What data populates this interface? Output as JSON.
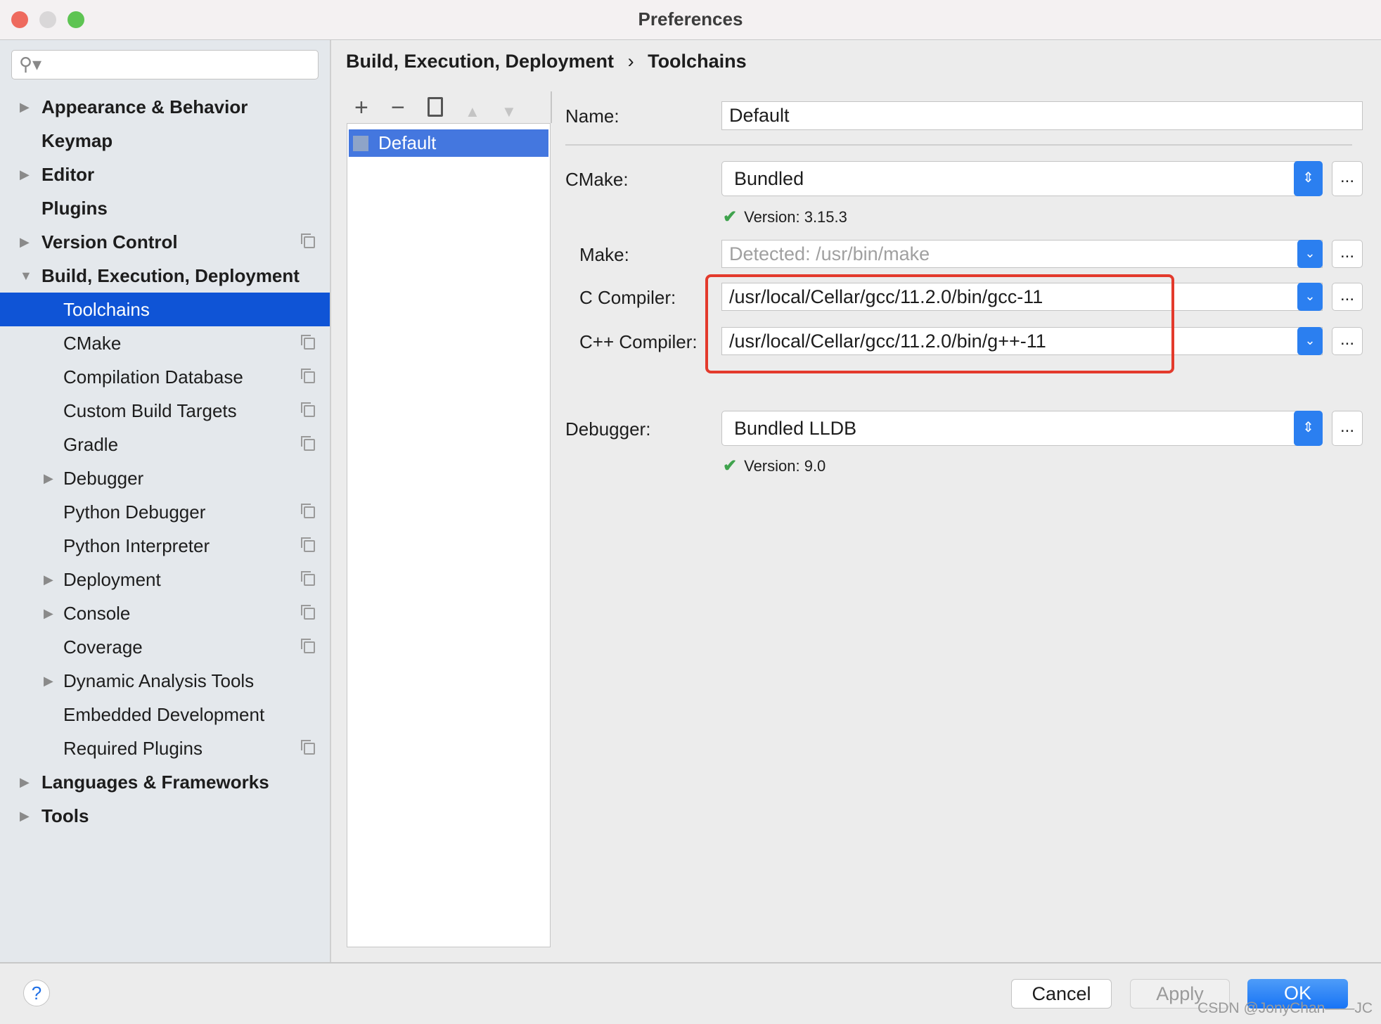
{
  "window": {
    "title": "Preferences"
  },
  "sidebar": {
    "search_placeholder": "",
    "items": [
      {
        "label": "Appearance & Behavior",
        "level": 0,
        "expandable": true,
        "bold": true
      },
      {
        "label": "Keymap",
        "level": 0,
        "bold": true
      },
      {
        "label": "Editor",
        "level": 0,
        "expandable": true,
        "bold": true
      },
      {
        "label": "Plugins",
        "level": 0,
        "bold": true
      },
      {
        "label": "Version Control",
        "level": 0,
        "expandable": true,
        "bold": true,
        "copy_icon": true
      },
      {
        "label": "Build, Execution, Deployment",
        "level": 0,
        "expanded": true,
        "bold": true
      },
      {
        "label": "Toolchains",
        "level": 1,
        "selected": true
      },
      {
        "label": "CMake",
        "level": 1,
        "copy_icon": true
      },
      {
        "label": "Compilation Database",
        "level": 1,
        "copy_icon": true
      },
      {
        "label": "Custom Build Targets",
        "level": 1,
        "copy_icon": true
      },
      {
        "label": "Gradle",
        "level": 1,
        "copy_icon": true
      },
      {
        "label": "Debugger",
        "level": 1,
        "expandable": true
      },
      {
        "label": "Python Debugger",
        "level": 1,
        "copy_icon": true
      },
      {
        "label": "Python Interpreter",
        "level": 1,
        "copy_icon": true
      },
      {
        "label": "Deployment",
        "level": 1,
        "expandable": true,
        "copy_icon": true
      },
      {
        "label": "Console",
        "level": 1,
        "expandable": true,
        "copy_icon": true
      },
      {
        "label": "Coverage",
        "level": 1,
        "copy_icon": true
      },
      {
        "label": "Dynamic Analysis Tools",
        "level": 1,
        "expandable": true
      },
      {
        "label": "Embedded Development",
        "level": 1
      },
      {
        "label": "Required Plugins",
        "level": 1,
        "copy_icon": true
      },
      {
        "label": "Languages & Frameworks",
        "level": 0,
        "expandable": true,
        "bold": true
      },
      {
        "label": "Tools",
        "level": 0,
        "expandable": true,
        "bold": true
      }
    ]
  },
  "breadcrumb": {
    "parent": "Build, Execution, Deployment",
    "separator": "›",
    "current": "Toolchains"
  },
  "toolbar": {
    "add": "+",
    "remove": "−",
    "up": "▲",
    "down": "▼"
  },
  "toolchains_list": {
    "items": [
      "Default"
    ]
  },
  "form": {
    "name_label": "Name:",
    "name_value": "Default",
    "cmake_label": "CMake:",
    "cmake_value": "Bundled",
    "cmake_version": "Version: 3.15.3",
    "make_label": "Make:",
    "make_placeholder": "Detected: /usr/bin/make",
    "c_label": "C Compiler:",
    "c_value": "/usr/local/Cellar/gcc/11.2.0/bin/gcc-11",
    "cpp_label": "C++ Compiler:",
    "cpp_value": "/usr/local/Cellar/gcc/11.2.0/bin/g++-11",
    "debugger_label": "Debugger:",
    "debugger_value": "Bundled LLDB",
    "debugger_version": "Version: 9.0",
    "browse": "..."
  },
  "buttons": {
    "help": "?",
    "cancel": "Cancel",
    "apply": "Apply",
    "ok": "OK"
  },
  "watermark": "CSDN @JonyChan——JC",
  "colors": {
    "selection": "#0f54d6",
    "accent": "#2b7ff0",
    "highlight_box": "#e33a2c"
  }
}
